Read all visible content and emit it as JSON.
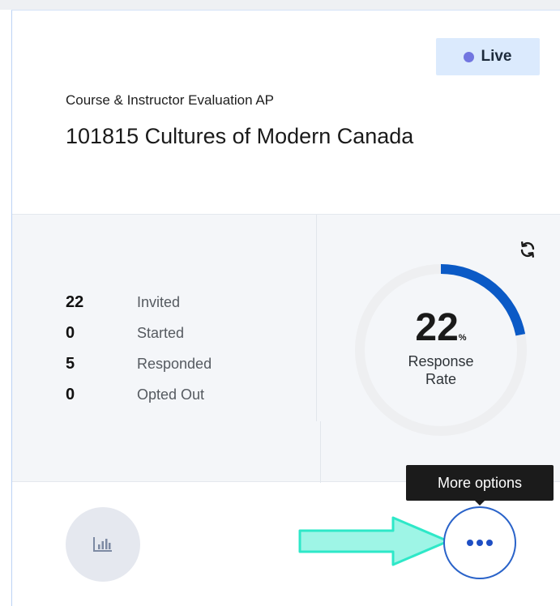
{
  "header": {
    "status_badge": "Live",
    "survey_type": "Course & Instructor Evaluation AP",
    "course_title": "101815 Cultures of Modern Canada"
  },
  "stats": [
    {
      "count": "22",
      "label": "Invited"
    },
    {
      "count": "0",
      "label": "Started"
    },
    {
      "count": "5",
      "label": "Responded"
    },
    {
      "count": "0",
      "label": "Opted Out"
    }
  ],
  "response_rate": {
    "value": "22",
    "unit": "%",
    "label_line1": "Response",
    "label_line2": "Rate",
    "fraction": 0.22
  },
  "actions": {
    "tooltip": "More options"
  },
  "colors": {
    "gauge_fill": "#0b5ac6",
    "gauge_track": "#eeeff1",
    "badge_bg": "#dbeafd",
    "badge_dot": "#7276e0",
    "annotation_arrow": "#2ee8c8"
  },
  "icons": {
    "refresh": "refresh-icon",
    "report": "bar-chart-icon",
    "more": "more-horizontal-icon"
  }
}
